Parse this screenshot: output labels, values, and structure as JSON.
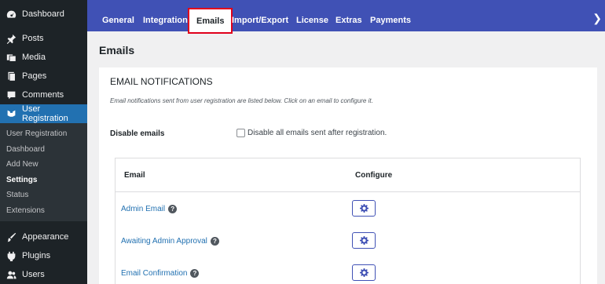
{
  "sidebar": {
    "top_items": [
      {
        "label": "Dashboard",
        "icon": "dashboard-icon"
      },
      {
        "label": "Posts",
        "icon": "pushpin-icon"
      },
      {
        "label": "Media",
        "icon": "media-icon"
      },
      {
        "label": "Pages",
        "icon": "pages-icon"
      },
      {
        "label": "Comments",
        "icon": "comment-icon"
      },
      {
        "label": "User Registration",
        "icon": "user-registration-icon"
      }
    ],
    "submenu": [
      "User Registration",
      "Dashboard",
      "Add New",
      "Settings",
      "Status",
      "Extensions"
    ],
    "bottom_items": [
      {
        "label": "Appearance",
        "icon": "brush-icon"
      },
      {
        "label": "Plugins",
        "icon": "plugin-icon"
      },
      {
        "label": "Users",
        "icon": "users-icon"
      }
    ]
  },
  "tabs": [
    "General",
    "Integration",
    "Emails",
    "Import/Export",
    "License",
    "Extras",
    "Payments"
  ],
  "page": {
    "title": "Emails",
    "section_title": "EMAIL NOTIFICATIONS",
    "section_desc": "Email notifications sent from user registration are listed below. Click on an email to configure it.",
    "disable_label": "Disable emails",
    "disable_text": "Disable all emails sent after registration."
  },
  "table": {
    "col_email": "Email",
    "col_configure": "Configure",
    "rows": [
      "Admin Email",
      "Awaiting Admin Approval",
      "Email Confirmation"
    ]
  },
  "colors": {
    "tabbar": "#4051b5",
    "sidebar": "#1d2327",
    "active": "#2271b1",
    "highlight": "#e0001b"
  }
}
